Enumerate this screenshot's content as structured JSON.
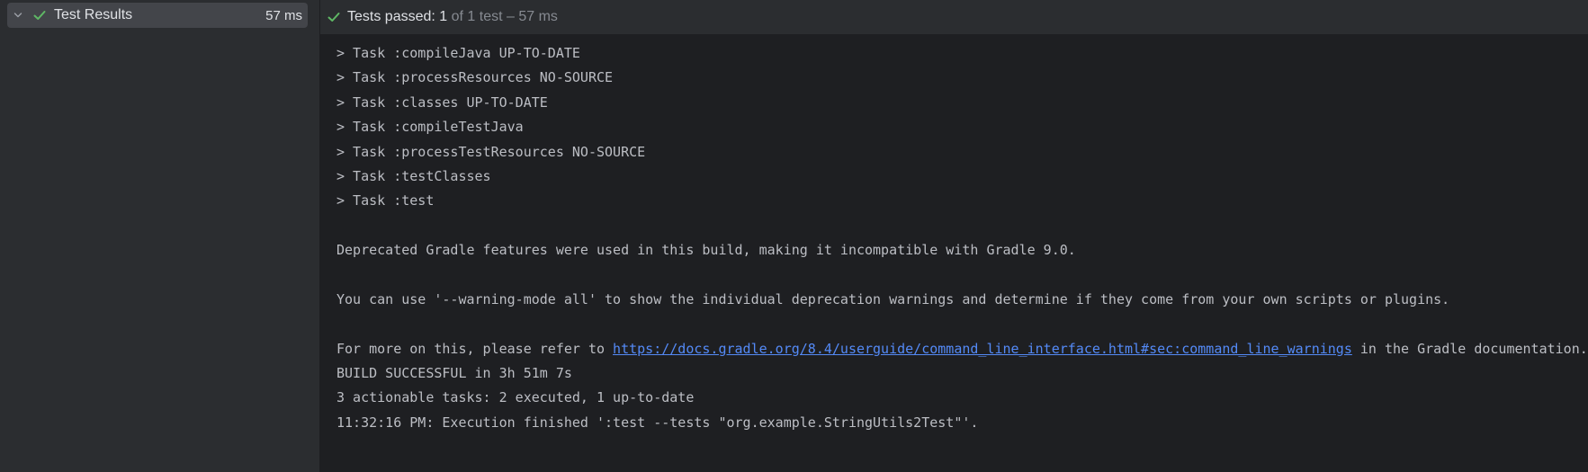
{
  "tree": {
    "root_label": "Test Results",
    "root_time": "57 ms",
    "expand_icon": "chevron-down-icon",
    "status_icon": "check-icon"
  },
  "status": {
    "icon": "check-icon",
    "passed_label": "Tests passed: 1",
    "detail": " of 1 test – 57 ms"
  },
  "colors": {
    "success": "#5fb865",
    "link": "#548af7"
  },
  "console": {
    "lines": [
      "> Task :compileJava UP-TO-DATE",
      "> Task :processResources NO-SOURCE",
      "> Task :classes UP-TO-DATE",
      "> Task :compileTestJava",
      "> Task :processTestResources NO-SOURCE",
      "> Task :testClasses",
      "> Task :test",
      "",
      "Deprecated Gradle features were used in this build, making it incompatible with Gradle 9.0.",
      "",
      "You can use '--warning-mode all' to show the individual deprecation warnings and determine if they come from your own scripts or plugins.",
      ""
    ],
    "refer_prefix": "For more on this, please refer to ",
    "refer_link": "https://docs.gradle.org/8.4/userguide/command_line_interface.html#sec:command_line_warnings",
    "refer_suffix": " in the Gradle documentation.",
    "tail_lines": [
      "BUILD SUCCESSFUL in 3h 51m 7s",
      "3 actionable tasks: 2 executed, 1 up-to-date",
      "11:32:16 PM: Execution finished ':test --tests \"org.example.StringUtils2Test\"'."
    ]
  }
}
